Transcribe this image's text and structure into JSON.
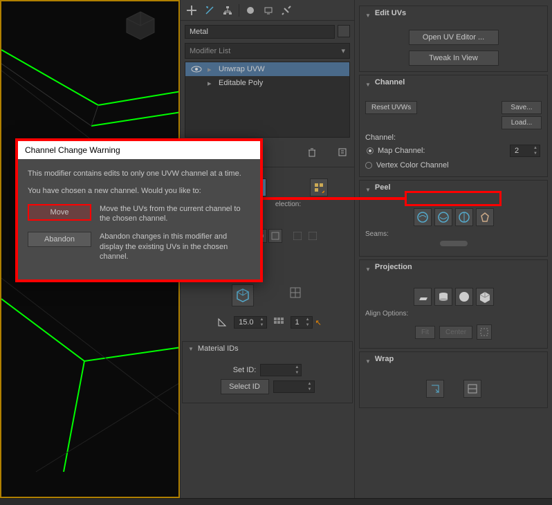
{
  "object_name": "Metal",
  "modifier_dropdown_label": "Modifier List",
  "stack": {
    "item0": "Unwrap UVW",
    "item1": "Editable Poly"
  },
  "dialog": {
    "title": "Channel Change Warning",
    "text1": "This modifier contains edits to only one UVW channel at a time.",
    "text2": "You have chosen a new channel. Would you like to:",
    "move_label": "Move",
    "move_desc": "Move the UVs from the current channel to the chosen channel.",
    "abandon_label": "Abandon",
    "abandon_desc": "Abandon changes in this modifier and display the existing UVs in the chosen channel."
  },
  "panels": {
    "edituvs": {
      "title": "Edit UVs",
      "open_editor": "Open UV Editor ...",
      "tweak": "Tweak In View"
    },
    "channel": {
      "title": "Channel",
      "reset": "Reset UVWs",
      "save": "Save...",
      "load": "Load...",
      "channel_label": "Channel:",
      "map_channel_label": "Map Channel:",
      "map_channel_value": "2",
      "vertex_color_label": "Vertex Color Channel"
    },
    "peel": {
      "title": "Peel",
      "seams_label": "Seams:"
    },
    "projection": {
      "title": "Projection",
      "align_label": "Align Options:",
      "fit": "Fit",
      "center": "Center"
    },
    "wrap": {
      "title": "Wrap"
    },
    "selection": {
      "label": "election:"
    },
    "material_ids": {
      "title": "Material IDs",
      "set_id": "Set ID:",
      "select_id": "Select ID"
    },
    "smooth_value": "15.0",
    "one_value": "1"
  }
}
